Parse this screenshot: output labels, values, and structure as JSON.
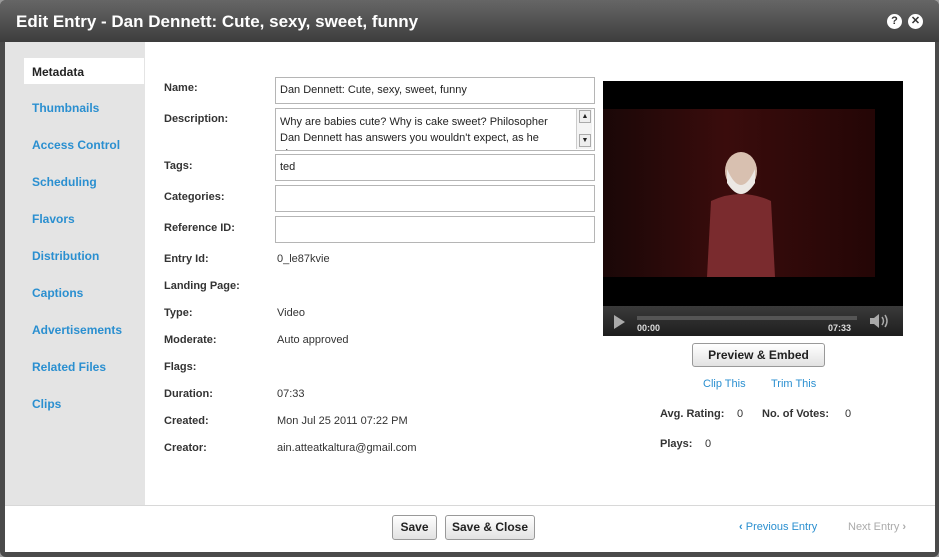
{
  "window": {
    "title": "Edit Entry - Dan Dennett: Cute, sexy, sweet, funny",
    "help_icon": "?",
    "close_icon": "✕"
  },
  "sidebar": {
    "items": [
      {
        "label": "Metadata",
        "active": true
      },
      {
        "label": "Thumbnails"
      },
      {
        "label": "Access Control"
      },
      {
        "label": "Scheduling"
      },
      {
        "label": "Flavors"
      },
      {
        "label": "Distribution"
      },
      {
        "label": "Captions"
      },
      {
        "label": "Advertisements"
      },
      {
        "label": "Related Files"
      },
      {
        "label": "Clips"
      }
    ]
  },
  "form": {
    "name_label": "Name:",
    "name_value": "Dan Dennett: Cute, sexy, sweet, funny",
    "description_label": "Description:",
    "description_value": "Why are babies cute? Why is cake sweet? Philosopher Dan Dennett has answers you wouldn't expect, as he shares",
    "tags_label": "Tags:",
    "tags_value": "ted",
    "categories_label": "Categories:",
    "categories_value": "",
    "reference_id_label": "Reference ID:",
    "reference_id_value": "",
    "entry_id_label": "Entry Id:",
    "entry_id_value": "0_le87kvie",
    "landing_page_label": "Landing Page:",
    "type_label": "Type:",
    "type_value": "Video",
    "moderate_label": "Moderate:",
    "moderate_value": "Auto approved",
    "flags_label": "Flags:",
    "duration_label": "Duration:",
    "duration_value": "07:33",
    "created_label": "Created:",
    "created_value": "Mon Jul 25 2011 07:22 PM",
    "creator_label": "Creator:",
    "creator_value": "ain.atteatkaltura@gmail.com"
  },
  "player": {
    "time_current": "00:00",
    "time_total": "07:33",
    "progress": 0,
    "preview_button": "Preview & Embed",
    "clip_link": "Clip This",
    "trim_link": "Trim This"
  },
  "stats": {
    "avg_rating_label": "Avg. Rating:",
    "avg_rating_value": "0",
    "votes_label": "No. of Votes:",
    "votes_value": "0",
    "plays_label": "Plays:",
    "plays_value": "0"
  },
  "footer": {
    "save": "Save",
    "save_close": "Save & Close",
    "prev_arrow": "‹",
    "prev": "Previous Entry",
    "next": "Next Entry",
    "next_arrow": "›"
  },
  "colors": {
    "accent_link": "#2a8fd0",
    "title_bar": "#4a4a4a"
  }
}
